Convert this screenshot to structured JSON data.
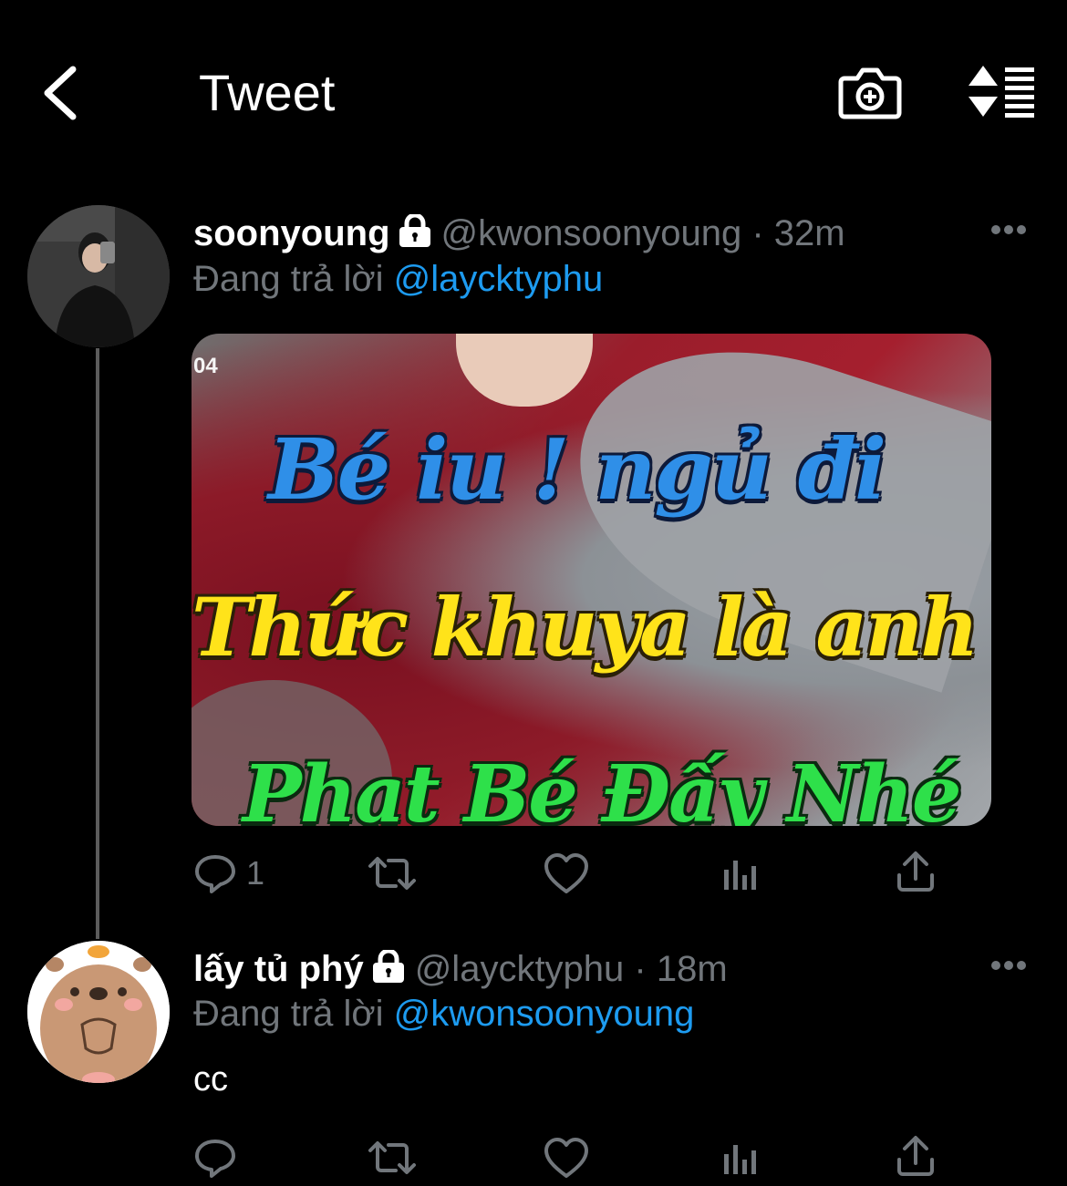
{
  "header": {
    "title": "Tweet"
  },
  "tweets": [
    {
      "display_name": "soonyoung",
      "handle": "@kwonsoonyoung",
      "time": "· 32m",
      "replying_prefix": "Đang trả lời",
      "replying_to": "@laycktyphu",
      "media": {
        "timestamp_fragment": "04",
        "caption_line1": "Bé iu ! ngủ đi",
        "caption_line2": "Thức khuya là anh",
        "caption_line3": "Phạt Bé Đấy Nhé"
      },
      "reply_count": "1"
    },
    {
      "display_name": "lấy tủ phý",
      "handle": "@laycktyphu",
      "time": "· 18m",
      "replying_prefix": "Đang trả lời",
      "replying_to": "@kwonsoonyoung",
      "text": "cc"
    }
  ],
  "icons": {
    "back": "chevron-left-icon",
    "camera": "camera-plus-icon",
    "sort": "sort-list-icon",
    "lock": "lock-icon",
    "more": "more-dots-icon",
    "reply": "reply-bubble-icon",
    "retweet": "retweet-icon",
    "like": "heart-icon",
    "analytics": "analytics-bars-icon",
    "share": "share-icon"
  },
  "colors": {
    "background": "#000000",
    "text_primary": "#ffffff",
    "text_secondary": "#71767b",
    "link": "#1d9bf0",
    "thread_line": "#5c5c5c"
  }
}
